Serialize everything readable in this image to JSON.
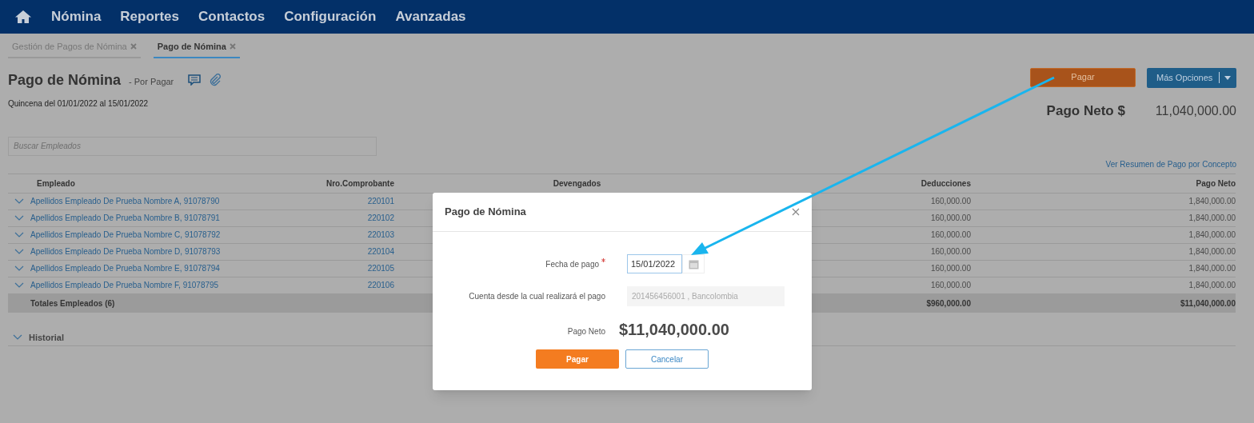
{
  "nav": {
    "items": [
      "Nómina",
      "Reportes",
      "Contactos",
      "Configuración",
      "Avanzadas"
    ]
  },
  "tabs": [
    {
      "label": "Gestión de Pagos de Nómina",
      "selected": false
    },
    {
      "label": "Pago de Nómina",
      "selected": true
    }
  ],
  "page": {
    "title": "Pago de Nómina",
    "status": "- Por Pagar",
    "period": "Quincena del 01/01/2022 al 15/01/2022",
    "search_placeholder": "Buscar Empleados",
    "pay_button": "Pagar",
    "more_button": "Más Opciones",
    "net_label": "Pago Neto $",
    "net_value": "11,040,000.00",
    "summary_link": "Ver Resumen de Pago por Concepto"
  },
  "table": {
    "columns": [
      "Empleado",
      "Nro.Comprobante",
      "Devengados",
      "Deducciones",
      "Pago Neto"
    ],
    "rows": [
      {
        "employee": "Apellidos Empleado De Prueba Nombre A, 91078790",
        "voucher": "220101",
        "deductions": "160,000.00",
        "net": "1,840,000.00"
      },
      {
        "employee": "Apellidos Empleado De Prueba Nombre B, 91078791",
        "voucher": "220102",
        "deductions": "160,000.00",
        "net": "1,840,000.00"
      },
      {
        "employee": "Apellidos Empleado De Prueba Nombre C, 91078792",
        "voucher": "220103",
        "deductions": "160,000.00",
        "net": "1,840,000.00"
      },
      {
        "employee": "Apellidos Empleado De Prueba Nombre D, 91078793",
        "voucher": "220104",
        "deductions": "160,000.00",
        "net": "1,840,000.00"
      },
      {
        "employee": "Apellidos Empleado De Prueba Nombre E, 91078794",
        "voucher": "220105",
        "deductions": "160,000.00",
        "net": "1,840,000.00"
      },
      {
        "employee": "Apellidos Empleado De Prueba Nombre F, 91078795",
        "voucher": "220106",
        "deductions": "160,000.00",
        "net": "1,840,000.00"
      }
    ],
    "totals": {
      "label": "Totales Empleados (6)",
      "deductions": "$960,000.00",
      "net": "$11,040,000.00"
    }
  },
  "history": {
    "label": "Historial"
  },
  "modal": {
    "title": "Pago de Nómina",
    "date_label": "Fecha de pago",
    "required": true,
    "date_value": "15/01/2022",
    "account_label": "Cuenta desde la cual realizará el pago",
    "account_value": "201456456001 , Bancolombia",
    "account_disabled": true,
    "net_label": "Pago Neto",
    "net_value": "$11,040,000.00",
    "pay_button": "Pagar",
    "cancel_button": "Cancelar"
  }
}
